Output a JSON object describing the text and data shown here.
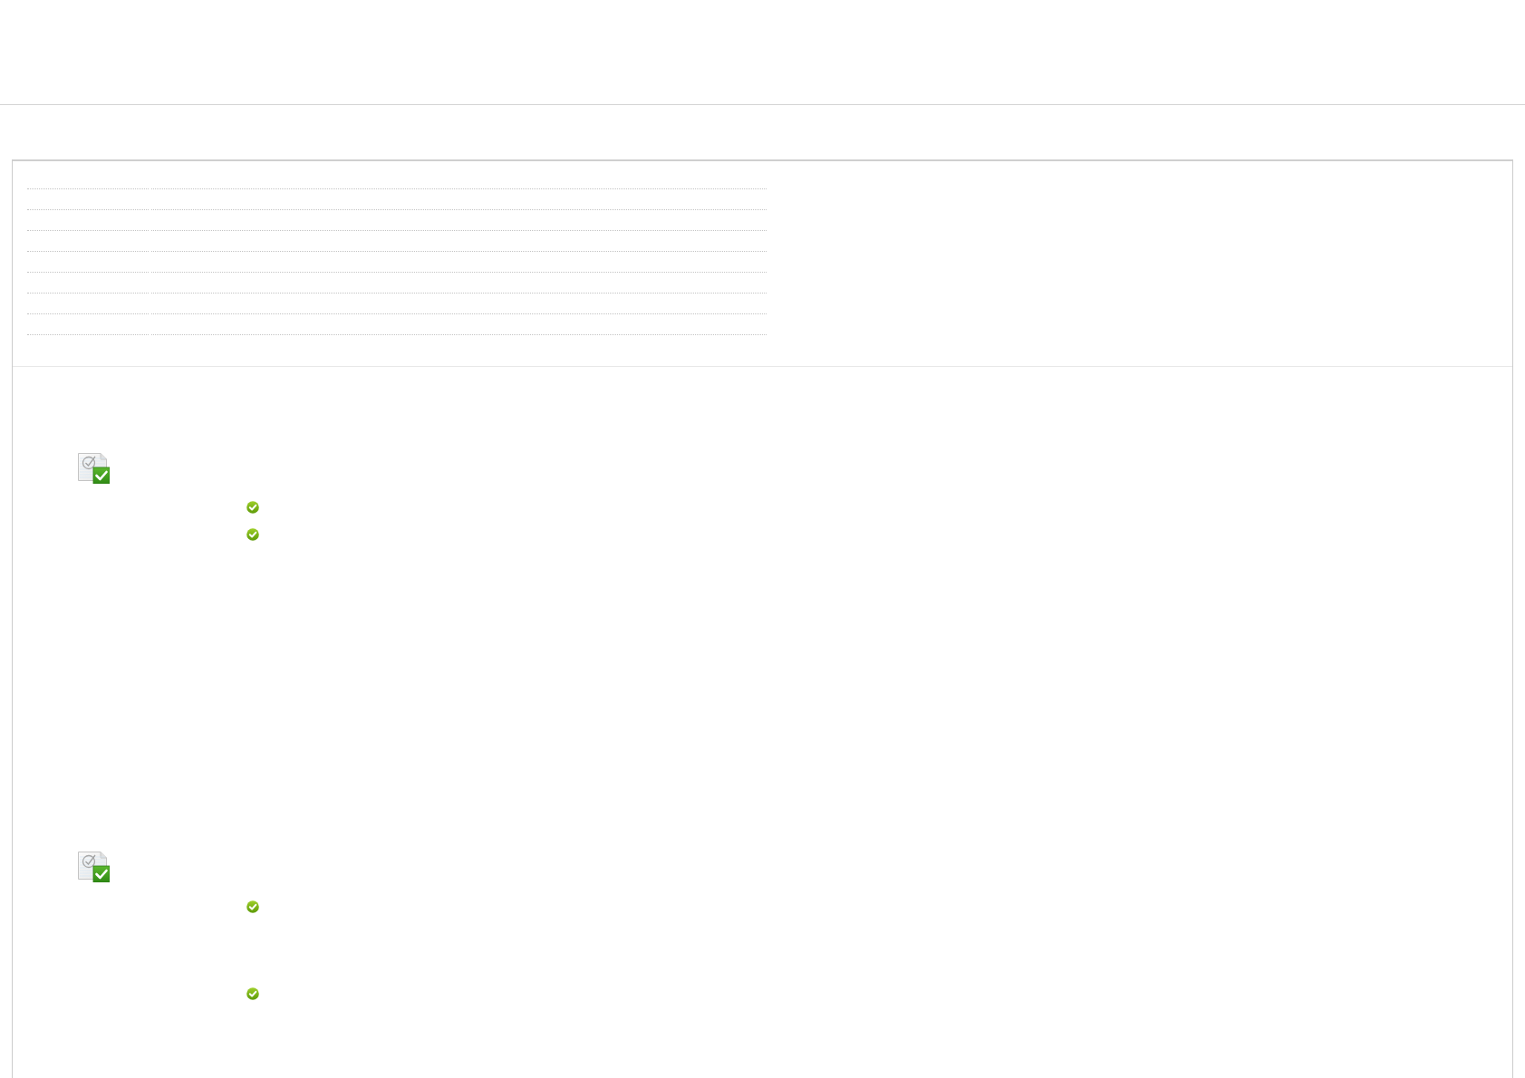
{
  "sections": [
    {
      "completed": true,
      "items": [
        {
          "checked": true
        },
        {
          "checked": true
        }
      ]
    },
    {
      "completed": true,
      "items": [
        {
          "checked": true
        },
        {
          "checked": true
        }
      ]
    }
  ]
}
